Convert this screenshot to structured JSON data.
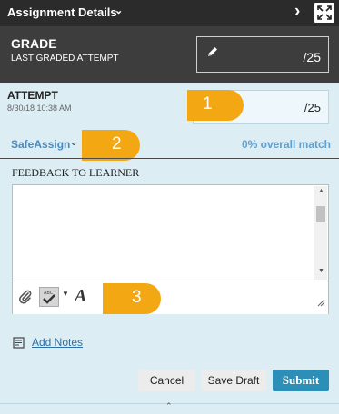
{
  "header": {
    "title": "Assignment Details",
    "title_chevron_icon": "chevron-down-icon",
    "next_icon": "chevron-right-icon",
    "expand_icon": "expand-icon"
  },
  "grade": {
    "label": "GRADE",
    "sublabel": "LAST GRADED ATTEMPT",
    "edit_icon": "pencil-icon",
    "max": "/25"
  },
  "attempt": {
    "label": "ATTEMPT",
    "date": "8/30/18 10:38 AM",
    "max": "/25"
  },
  "safeassign": {
    "label": "SafeAssign",
    "match": "0% overall match"
  },
  "feedback": {
    "label": "FEEDBACK TO LEARNER",
    "toolbar": {
      "attach_icon": "paperclip-icon",
      "spellcheck_icon": "spellcheck-icon",
      "dropdown_icon": "caret-down-icon",
      "font_glyph": "A"
    }
  },
  "callouts": [
    "1",
    "2",
    "3"
  ],
  "notes": {
    "label": "Add Notes",
    "icon": "notes-icon"
  },
  "actions": {
    "cancel": "Cancel",
    "save_draft": "Save Draft",
    "submit": "Submit"
  },
  "colors": {
    "accent": "#2b8fb8",
    "callout": "#f3a712",
    "panel_bg": "#dcedf4",
    "header_bg": "#2b2b2b",
    "grade_bg": "#3d3d3d",
    "link": "#4c8bb9"
  }
}
